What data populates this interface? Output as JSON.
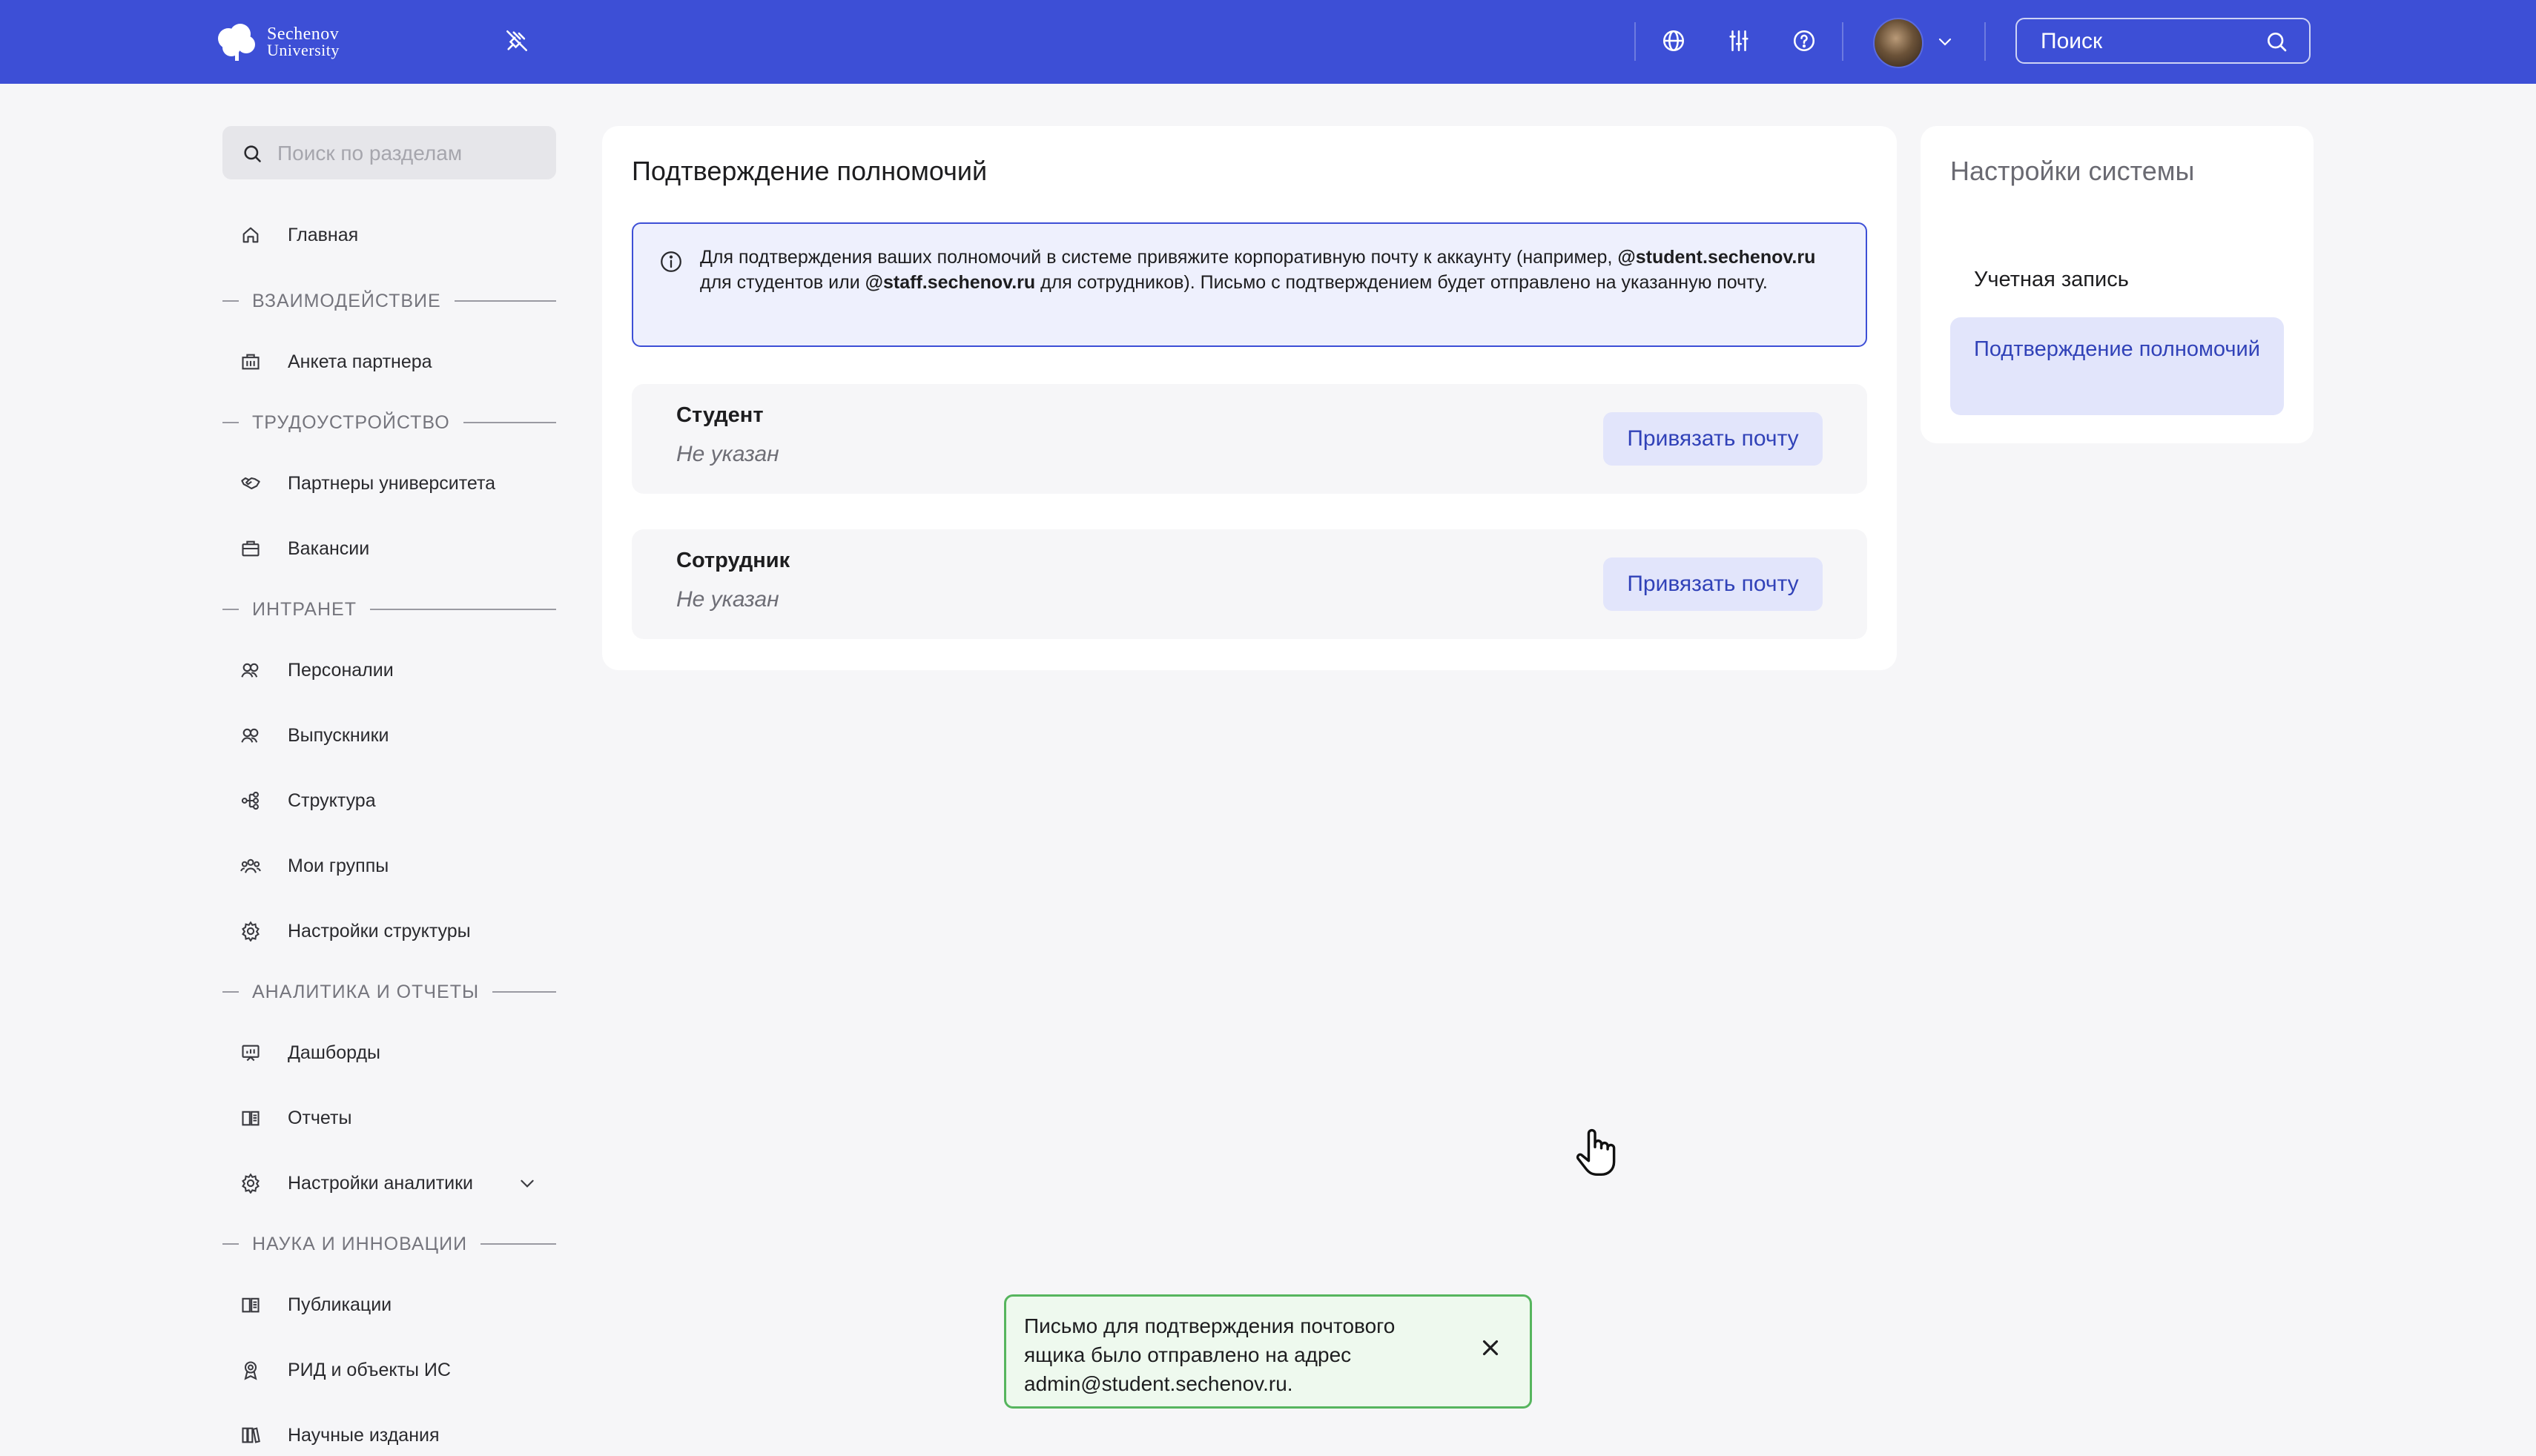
{
  "header": {
    "logo_line1": "Sechenov",
    "logo_line2": "University",
    "search_placeholder": "Поиск"
  },
  "sidebar": {
    "search_placeholder": "Поиск по разделам",
    "home": "Главная",
    "sections": [
      {
        "title": "ВЗАИМОДЕЙСТВИЕ",
        "items": [
          "Анкета партнера"
        ]
      },
      {
        "title": "ТРУДОУСТРОЙСТВО",
        "items": [
          "Партнеры университета",
          "Вакансии"
        ]
      },
      {
        "title": "ИНТРАНЕТ",
        "items": [
          "Персоналии",
          "Выпускники",
          "Структура",
          "Мои группы",
          "Настройки структуры"
        ]
      },
      {
        "title": "АНАЛИТИКА И ОТЧЕТЫ",
        "items": [
          "Дашборды",
          "Отчеты",
          "Настройки аналитики"
        ]
      },
      {
        "title": "НАУКА И ИННОВАЦИИ",
        "items": [
          "Публикации",
          "РИД и объекты ИС",
          "Научные издания"
        ]
      }
    ]
  },
  "main": {
    "title": "Подтверждение полномочий",
    "info": {
      "p1": "Для подтверждения ваших полномочий в системе привяжите корпоративную почту к аккаунту (например, ",
      "d1": "@student.sechenov.ru",
      "p2": " для студентов или ",
      "d2": "@staff.sechenov.ru",
      "p3": " для сотрудников). Письмо с подтверждением будет отправлено на указанную почту."
    },
    "rows": [
      {
        "name": "Студент",
        "value": "Не указан",
        "button": "Привязать почту"
      },
      {
        "name": "Сотрудник",
        "value": "Не указан",
        "button": "Привязать почту"
      }
    ]
  },
  "settings": {
    "title": "Настройки системы",
    "links": [
      "Учетная запись",
      "Подтверждение полномочий"
    ],
    "active": "Подтверждение полномочий"
  },
  "toast": {
    "message": "Письмо для подтверждения почтового ящика было отправлено на адрес admin@student.sechenov.ru."
  },
  "colors": {
    "accent": "#3d4fd6",
    "accent_light": "#e2e5fb",
    "toast_border": "#56b55e",
    "page_bg": "#f6f6f8"
  }
}
